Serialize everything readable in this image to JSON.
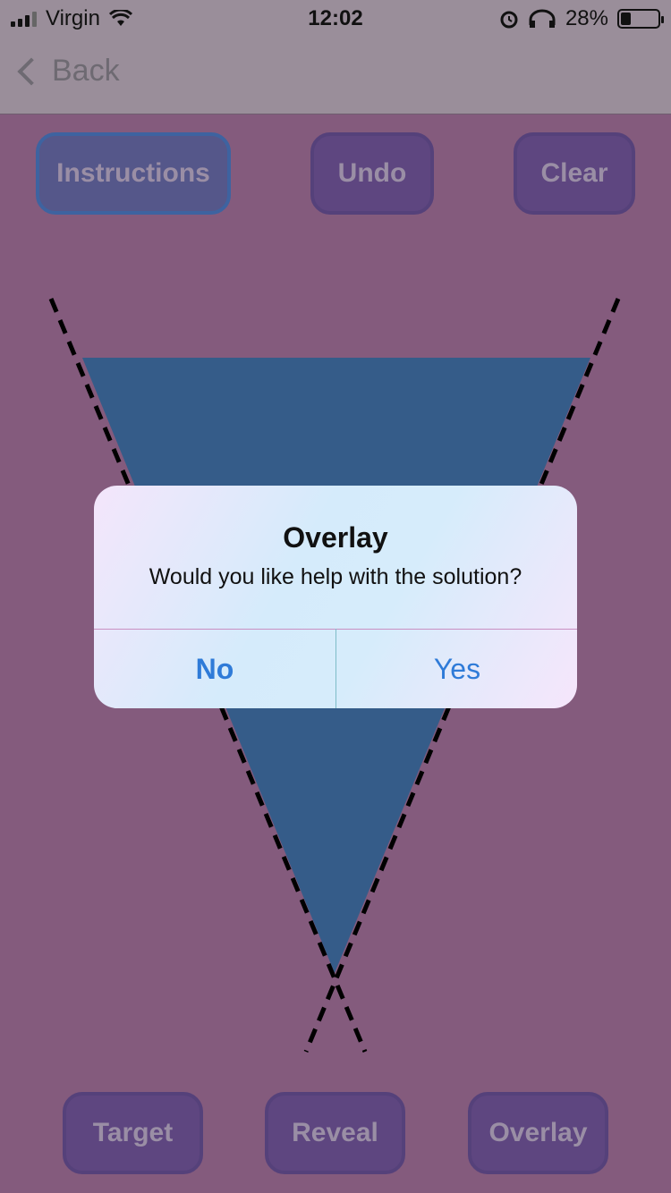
{
  "status_bar": {
    "carrier": "Virgin",
    "time": "12:02",
    "battery_percent": "28%",
    "battery_level": 0.28,
    "icons": [
      "signal-icon",
      "wifi-icon",
      "alarm-icon",
      "headphones-icon",
      "battery-icon"
    ]
  },
  "nav": {
    "back_label": "Back"
  },
  "toolbar": {
    "instructions_label": "Instructions",
    "undo_label": "Undo",
    "clear_label": "Clear"
  },
  "bottom_bar": {
    "target_label": "Target",
    "reveal_label": "Reveal",
    "overlay_label": "Overlay"
  },
  "alert": {
    "title": "Overlay",
    "message": "Would you like help with the solution?",
    "no_label": "No",
    "yes_label": "Yes"
  },
  "colors": {
    "background": "#845b7d",
    "triangle": "#355c89",
    "button": "#5e4680",
    "alert_action": "#2f7bd8"
  }
}
